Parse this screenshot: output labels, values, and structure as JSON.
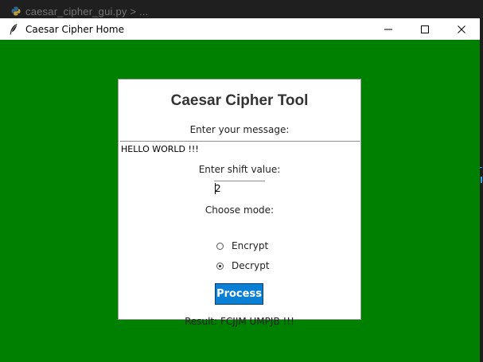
{
  "editor": {
    "tab_label": "caesar_cipher_gui.py > ..."
  },
  "window": {
    "title": "Caesar Cipher Home",
    "background": "#008000"
  },
  "card": {
    "heading": "Caesar Cipher Tool",
    "message_label": "Enter your message:",
    "message_value": "HELLO WORLD !!!",
    "shift_label": "Enter shift value:",
    "shift_value": "2",
    "mode_label": "Choose mode:",
    "modes": [
      {
        "label": "Encrypt",
        "selected": false
      },
      {
        "label": "Decrypt",
        "selected": true
      }
    ],
    "process_label": "Process",
    "process_color": "#0a7fd6",
    "result_text": "Result: FCJJM UMPJB !!!"
  },
  "icons": {
    "app": "feather-icon",
    "minimize": "minimize-icon",
    "maximize": "maximize-icon",
    "close": "close-icon",
    "file": "python-file-icon"
  }
}
